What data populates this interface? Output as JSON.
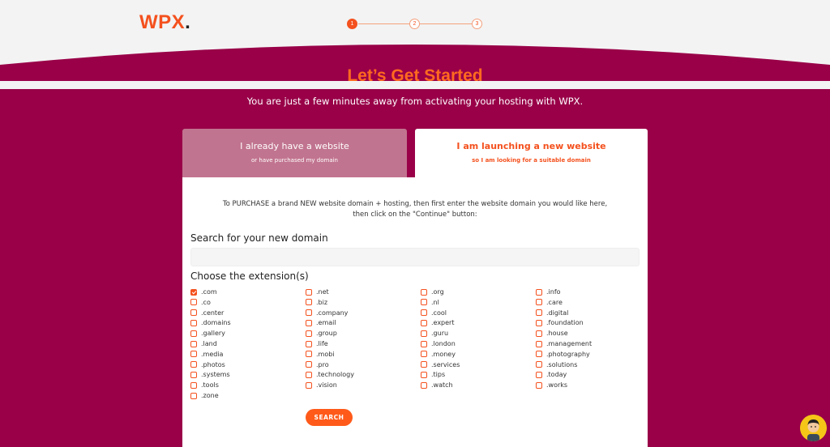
{
  "header": {
    "logo_text": "WPX",
    "logo_dot": ".",
    "steps": [
      "1",
      "2",
      "3"
    ],
    "active_step": 1
  },
  "hero": {
    "title": "Let’s Get Started",
    "subtitle": "You are just a few minutes away from activating your hosting with WPX."
  },
  "tabs": [
    {
      "title": "I already have a website",
      "subtitle": "or have purchased my domain",
      "selected": false
    },
    {
      "title": "I am launching a new website",
      "subtitle": "so I am looking for a suitable domain",
      "selected": true
    }
  ],
  "form": {
    "intro_line1": "To PURCHASE a brand NEW website domain + hosting, then first enter the website domain you would like here,",
    "intro_line2": "then click on the \"Continue\" button:",
    "search_label": "Search for your new domain",
    "search_value": "",
    "search_placeholder": "",
    "extensions_label": "Choose the extension(s)",
    "extension_columns": [
      [
        ".com",
        ".co",
        ".center",
        ".domains",
        ".gallery",
        ".land",
        ".media",
        ".photos",
        ".systems",
        ".tools",
        ".zone"
      ],
      [
        ".net",
        ".biz",
        ".company",
        ".email",
        ".group",
        ".life",
        ".mobi",
        ".pro",
        ".technology",
        ".vision"
      ],
      [
        ".org",
        ".nl",
        ".cool",
        ".expert",
        ".guru",
        ".london",
        ".money",
        ".services",
        ".tips",
        ".watch"
      ],
      [
        ".info",
        ".care",
        ".digital",
        ".foundation",
        ".house",
        ".management",
        ".photography",
        ".solutions",
        ".today",
        ".works"
      ]
    ],
    "checked_extensions": [
      ".com"
    ],
    "search_button": "SEARCH"
  },
  "colors": {
    "brand_orange": "#f4511e",
    "background_magenta": "#990048",
    "inactive_tab": "#c1748f"
  },
  "icons": {
    "avatar": "user-avatar-icon"
  }
}
